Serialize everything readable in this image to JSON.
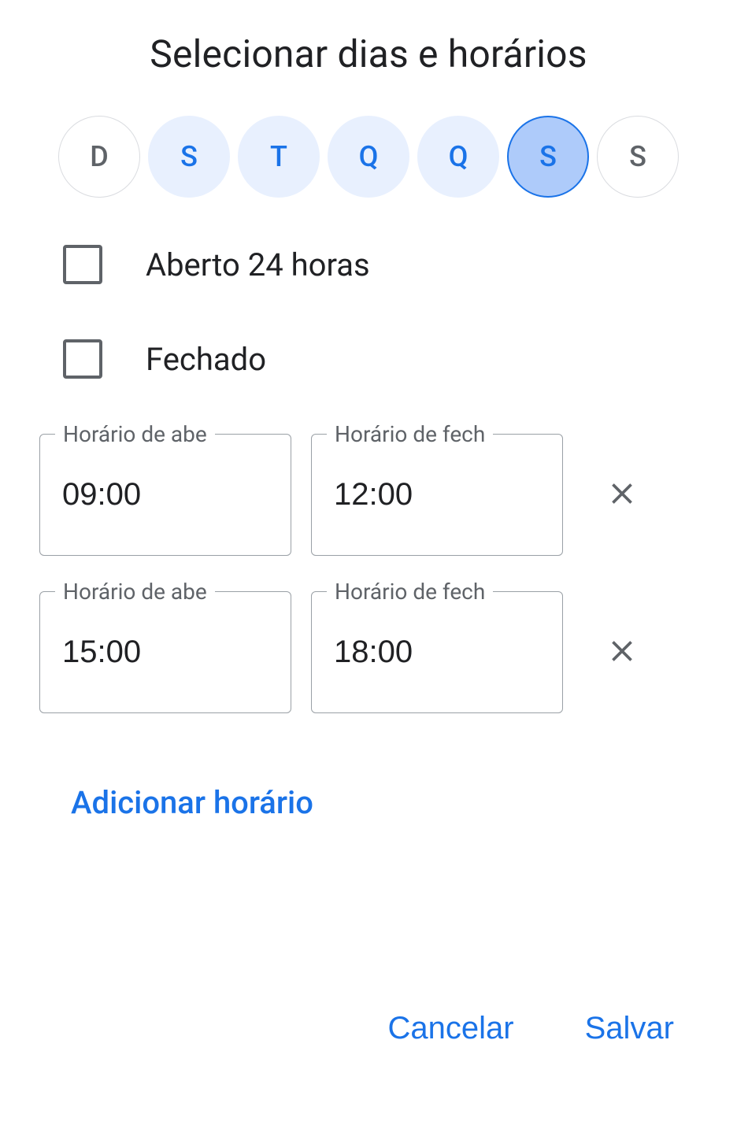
{
  "title": "Selecionar dias e horários",
  "days": [
    {
      "label": "D",
      "state": "unsel"
    },
    {
      "label": "S",
      "state": "sel"
    },
    {
      "label": "T",
      "state": "sel"
    },
    {
      "label": "Q",
      "state": "sel"
    },
    {
      "label": "Q",
      "state": "sel"
    },
    {
      "label": "S",
      "state": "active"
    },
    {
      "label": "S",
      "state": "unsel"
    }
  ],
  "options": {
    "open24_label": "Aberto 24 horas",
    "closed_label": "Fechado"
  },
  "labels": {
    "open": "Horário de abe",
    "close": "Horário de fech"
  },
  "timeslots": [
    {
      "open": "09:00",
      "close": "12:00"
    },
    {
      "open": "15:00",
      "close": "18:00"
    }
  ],
  "add_hours": "Adicionar horário",
  "buttons": {
    "cancel": "Cancelar",
    "save": "Salvar"
  }
}
